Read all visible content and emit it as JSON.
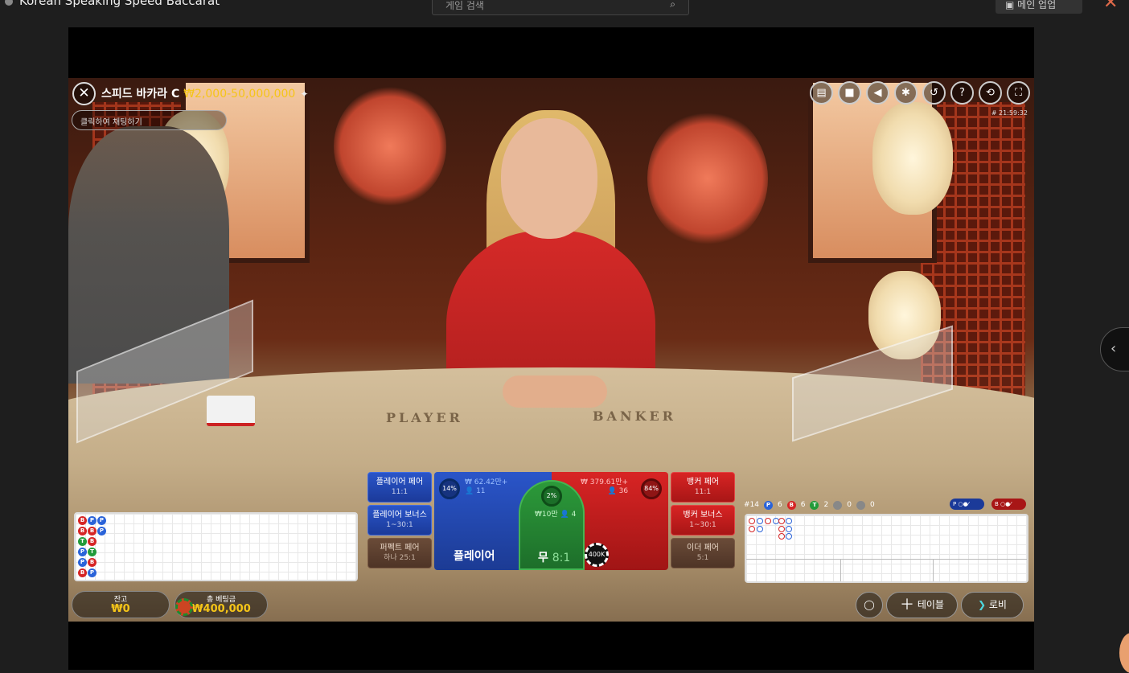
{
  "browser": {
    "window_title": "Korean Speaking Speed Baccarat",
    "search_placeholder": "게임 검색",
    "search_icon": "search-icon",
    "top_button_label": "메인 업업",
    "close_icon": "close-icon"
  },
  "hud": {
    "title": "스피드 바카라 C",
    "limit": "₩2,000-50,000,000",
    "chat_placeholder": "클릭하여 채팅하기",
    "timestamp": "# 21:59:32",
    "icons": [
      "chat-icon",
      "video-icon",
      "sound-icon",
      "settings-icon",
      "history-icon",
      "help-icon",
      "sync-icon",
      "fullscreen-icon"
    ]
  },
  "scene": {
    "player_word": "PLAYER",
    "banker_word": "BANKER"
  },
  "bets": {
    "player_pair": {
      "label": "플레이어 페어",
      "odds": "11:1"
    },
    "player_bonus": {
      "label": "플레이어 보너스",
      "odds": "1~30:1"
    },
    "perfect_pair": {
      "label": "퍼펙트 페어",
      "odds": "하나 25:1"
    },
    "banker_pair": {
      "label": "뱅커 페어",
      "odds": "11:1"
    },
    "banker_bonus": {
      "label": "뱅커 보너스",
      "odds": "1~30:1"
    },
    "either_pair": {
      "label": "이더 페어",
      "odds": "5:1"
    },
    "player": {
      "label": "플레이어",
      "pct": "14%",
      "amount": "₩ 62.42만+",
      "players": "11"
    },
    "tie": {
      "label": "무",
      "odds": "8:1",
      "pct": "2%",
      "amount": "₩10만",
      "players": "4"
    },
    "banker": {
      "label": "뱅커",
      "pct": "84%",
      "amount": "₩ 379.61만+",
      "players": "36"
    },
    "chip_value": "400K"
  },
  "bead_road": [
    [
      "B",
      "P",
      "P"
    ],
    [
      "B",
      "B",
      "P"
    ],
    [
      "T",
      "B"
    ],
    [
      "P",
      "T"
    ],
    [
      "P",
      "B"
    ],
    [
      "B",
      "P"
    ]
  ],
  "stats": {
    "round": "#14",
    "player": "6",
    "banker": "6",
    "tie": "2",
    "player_pair": "0",
    "banker_pair": "0",
    "predict_player": "P",
    "predict_banker": "B"
  },
  "colors": {
    "player_blue": "#2a55c9",
    "banker_red": "#d82424",
    "tie_green": "#2c9a3a",
    "gold": "#f5c518"
  },
  "footer": {
    "balance_label": "잔고",
    "balance_value": "₩0",
    "total_bet_label": "총 베팅금",
    "total_bet_value": "₩400,000",
    "tables_label": "테이블",
    "lobby_label": "로비"
  }
}
